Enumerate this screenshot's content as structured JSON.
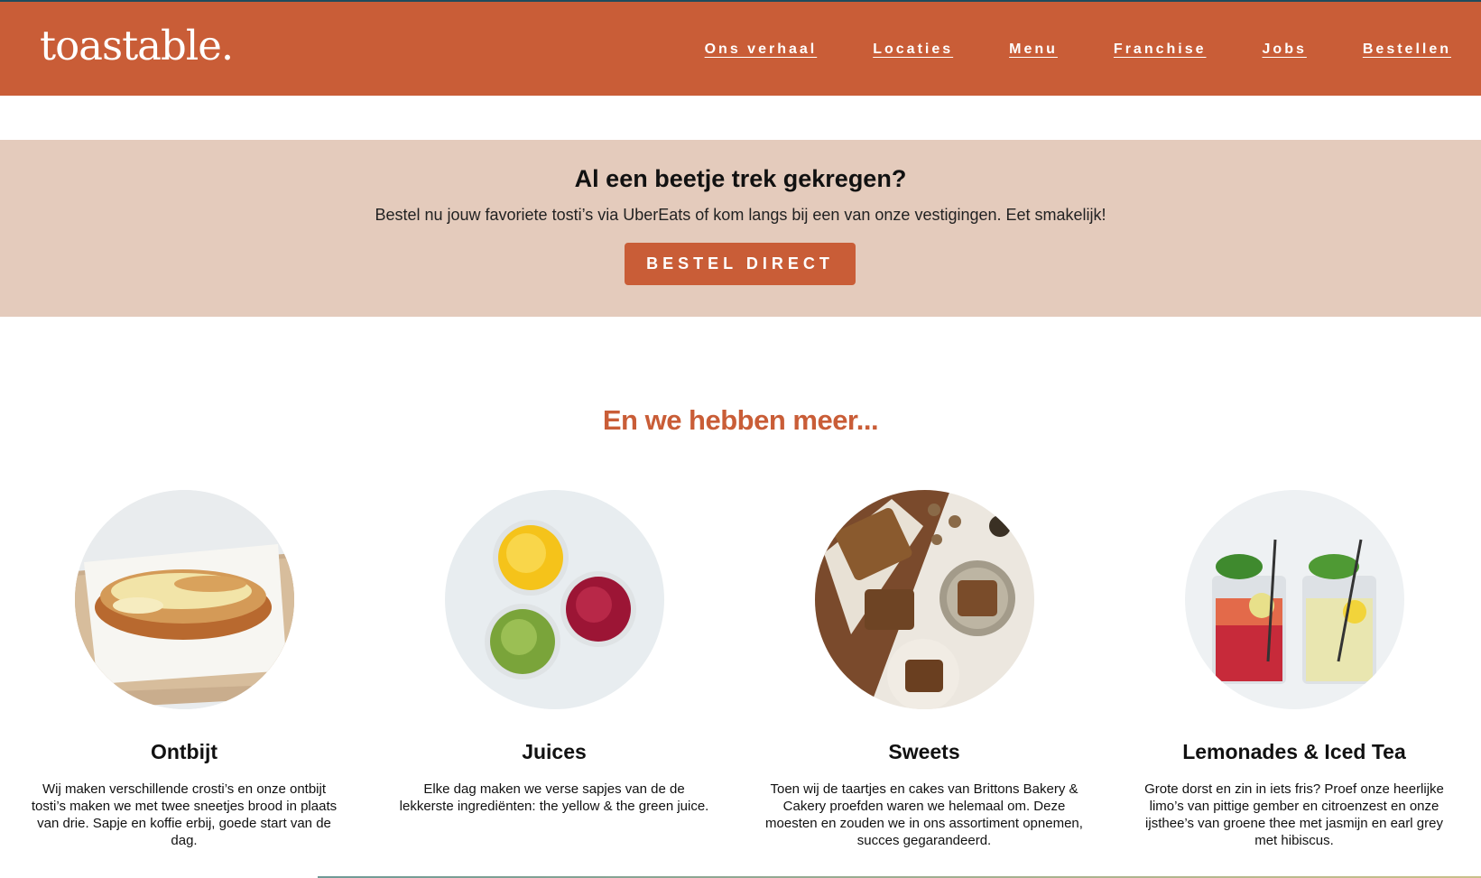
{
  "header": {
    "logo": "toastable.",
    "nav": [
      {
        "label": "Ons verhaal"
      },
      {
        "label": "Locaties"
      },
      {
        "label": "Menu"
      },
      {
        "label": "Franchise"
      },
      {
        "label": "Jobs"
      },
      {
        "label": "Bestellen"
      }
    ]
  },
  "promo": {
    "title": "Al een beetje trek gekregen?",
    "text": "Bestel nu jouw favoriete tosti’s via UberEats of kom langs bij een van onze vestigingen. Eet smakelijk!",
    "button": "BESTEL DIRECT"
  },
  "more": {
    "title": "En we hebben meer...",
    "cards": [
      {
        "title": "Ontbijt",
        "text": "Wij maken verschillende crosti’s en onze ontbijt tosti’s maken we met twee sneetjes brood in plaats van drie. Sapje en koffie erbij, goede start van de dag."
      },
      {
        "title": "Juices",
        "text": "Elke dag maken we verse sapjes van de de lekkerste ingrediënten: the yellow & the green juice."
      },
      {
        "title": "Sweets",
        "text": "Toen wij de taartjes en cakes van Brittons Bakery & Cakery proefden waren we helemaal om. Deze moesten en zouden we in ons assortiment opnemen, succes gegarandeerd."
      },
      {
        "title": "Lemonades & Iced Tea",
        "text": "Grote dorst en zin in iets fris? Proef onze heerlijke limo’s van pittige gember en citroenzest en onze ijsthee’s van groene thee met jasmijn en earl grey met hibiscus."
      }
    ]
  },
  "colors": {
    "brand": "#c95d37",
    "promo_bg": "#e4cbbc"
  }
}
